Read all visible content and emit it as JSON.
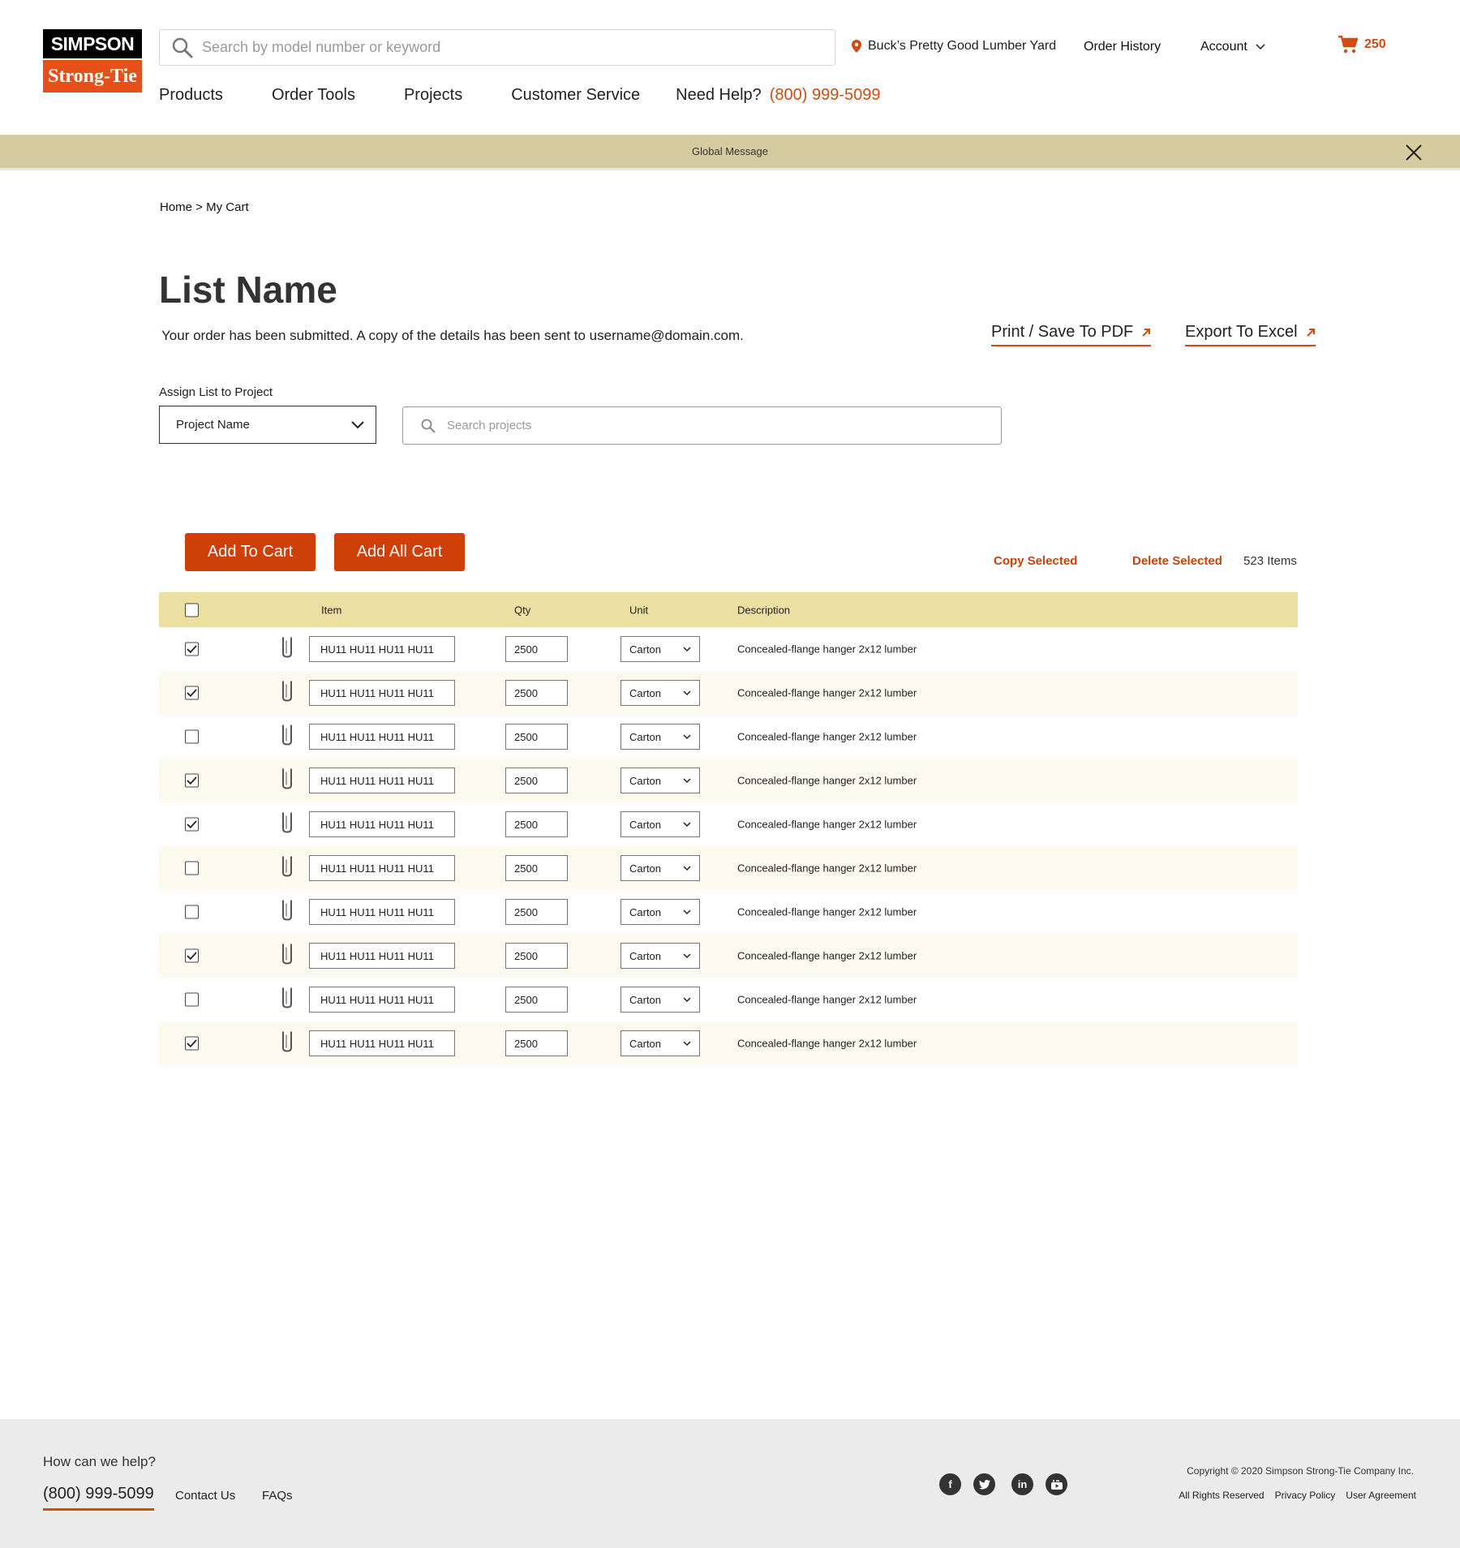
{
  "brand": {
    "logo_top": "SIMPSON",
    "logo_bottom": "Strong-Tie",
    "accent": "#cf4008"
  },
  "header": {
    "search_placeholder": "Search by model number or keyword",
    "location": "Buck’s Pretty Good Lumber Yard",
    "order_history": "Order History",
    "account": "Account",
    "cart_count": "250"
  },
  "nav": {
    "items": [
      "Products",
      "Order Tools",
      "Projects",
      "Customer Service"
    ],
    "help_label": "Need Help?",
    "help_phone": "(800) 999-5099"
  },
  "global_message": "Global Message",
  "breadcrumb": "Home > My Cart",
  "page": {
    "title": "List Name",
    "submitted_text": "Your order has been submitted. A copy of the details has been sent to username@domain.com.",
    "print_link": "Print / Save To PDF",
    "excel_link": "Export To Excel",
    "assign_label": "Assign List to Project",
    "project_select": "Project Name",
    "project_search_placeholder": "Search projects"
  },
  "actions": {
    "add_to_cart": "Add To Cart",
    "add_all_cart": "Add All Cart",
    "copy_selected": "Copy Selected",
    "delete_selected": "Delete Selected",
    "items_count": "523 Items"
  },
  "table": {
    "headers": {
      "item": "Item",
      "qty": "Qty",
      "unit": "Unit",
      "description": "Description"
    },
    "header_checked": false,
    "rows": [
      {
        "checked": true,
        "item": "HU11  HU11 HU11 HU11",
        "qty": "2500",
        "unit": "Carton",
        "description": "Concealed-flange hanger 2x12 lumber"
      },
      {
        "checked": true,
        "item": "HU11  HU11 HU11 HU11",
        "qty": "2500",
        "unit": "Carton",
        "description": "Concealed-flange hanger 2x12 lumber"
      },
      {
        "checked": false,
        "item": "HU11  HU11 HU11 HU11",
        "qty": "2500",
        "unit": "Carton",
        "description": "Concealed-flange hanger 2x12 lumber"
      },
      {
        "checked": true,
        "item": "HU11  HU11 HU11 HU11",
        "qty": "2500",
        "unit": "Carton",
        "description": "Concealed-flange hanger 2x12 lumber"
      },
      {
        "checked": true,
        "item": "HU11  HU11 HU11 HU11",
        "qty": "2500",
        "unit": "Carton",
        "description": "Concealed-flange hanger 2x12 lumber"
      },
      {
        "checked": false,
        "item": "HU11  HU11 HU11 HU11",
        "qty": "2500",
        "unit": "Carton",
        "description": "Concealed-flange hanger 2x12 lumber"
      },
      {
        "checked": false,
        "item": "HU11  HU11 HU11 HU11",
        "qty": "2500",
        "unit": "Carton",
        "description": "Concealed-flange hanger 2x12 lumber"
      },
      {
        "checked": true,
        "item": "HU11  HU11 HU11 HU11",
        "qty": "2500",
        "unit": "Carton",
        "description": "Concealed-flange hanger 2x12 lumber"
      },
      {
        "checked": false,
        "item": "HU11  HU11 HU11 HU11",
        "qty": "2500",
        "unit": "Carton",
        "description": "Concealed-flange hanger 2x12 lumber"
      },
      {
        "checked": true,
        "item": "HU11  HU11 HU11 HU11",
        "qty": "2500",
        "unit": "Carton",
        "description": "Concealed-flange hanger 2x12 lumber"
      }
    ]
  },
  "footer": {
    "help": "How can we help?",
    "phone": "(800) 999-5099",
    "contact": "Contact Us",
    "faqs": "FAQs",
    "social": [
      "facebook-icon",
      "twitter-icon",
      "linkedin-icon",
      "youtube-icon"
    ],
    "copyright": "Copyright © 2020 Simpson Strong-Tie Company Inc.",
    "links": [
      "All Rights Reserved",
      "Privacy Policy",
      "User Agreement"
    ]
  }
}
